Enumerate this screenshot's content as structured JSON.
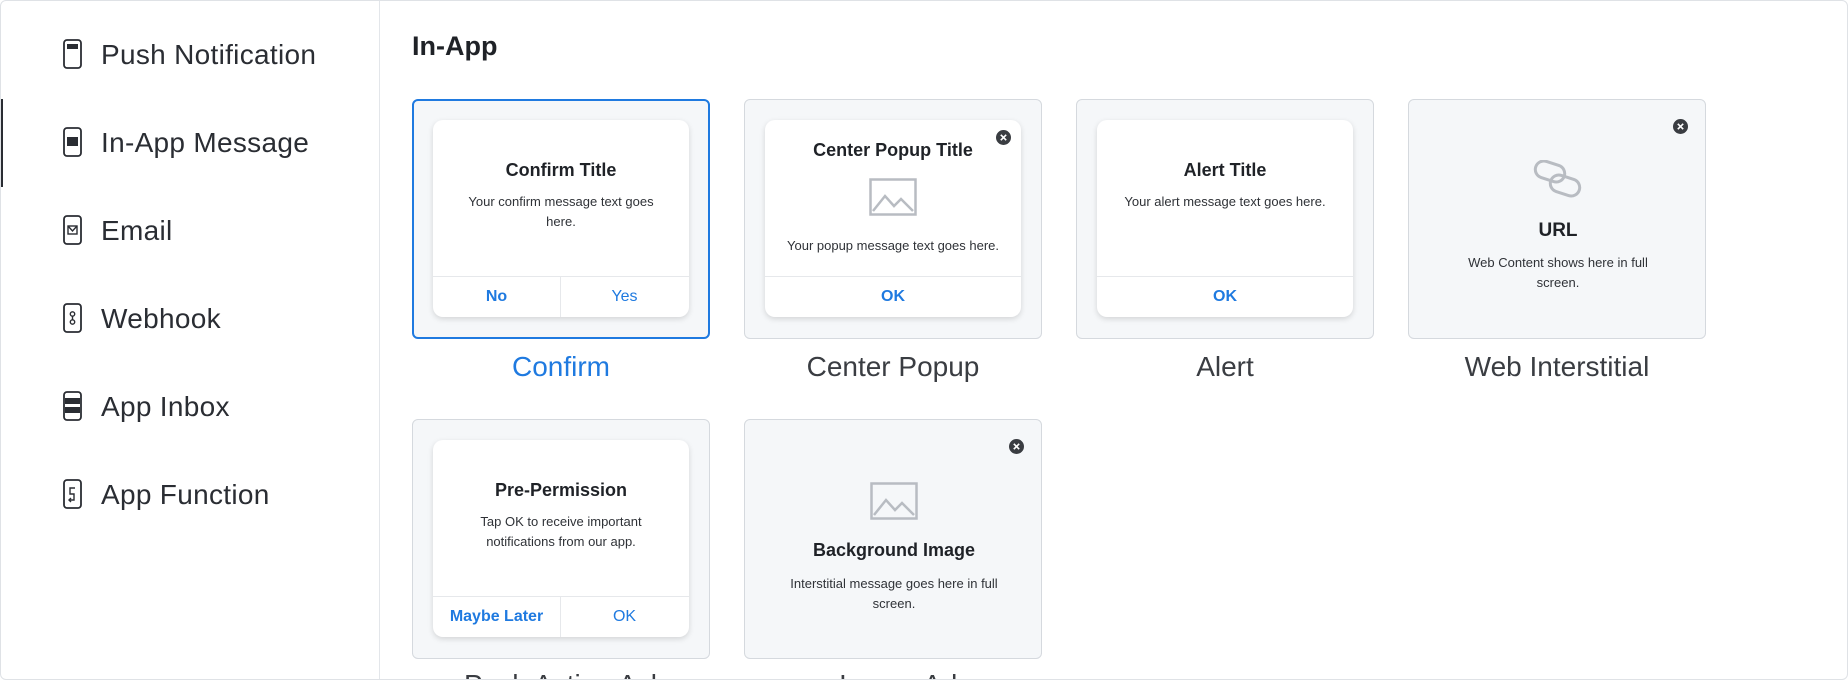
{
  "sidebar": {
    "items": [
      {
        "label": "Push Notification",
        "icon": "phone-push-icon"
      },
      {
        "label": "In-App Message",
        "icon": "phone-inapp-icon",
        "active": true
      },
      {
        "label": "Email",
        "icon": "phone-email-icon"
      },
      {
        "label": "Webhook",
        "icon": "phone-webhook-icon"
      },
      {
        "label": "App Inbox",
        "icon": "phone-inbox-icon"
      },
      {
        "label": "App Function",
        "icon": "phone-function-icon"
      }
    ]
  },
  "main": {
    "section_title": "In-App",
    "templates": [
      {
        "label": "Confirm",
        "title": "Confirm Title",
        "text": "Your confirm message text goes here.",
        "actions": [
          "No",
          "Yes"
        ]
      },
      {
        "label": "Center Popup",
        "title": "Center Popup Title",
        "text": "Your popup message text goes here.",
        "actions": [
          "OK"
        ]
      },
      {
        "label": "Alert",
        "title": "Alert Title",
        "text": "Your alert message text goes here.",
        "actions": [
          "OK"
        ]
      },
      {
        "label": "Web Interstitial",
        "title": "URL",
        "text": "Web Content shows here in full screen."
      },
      {
        "label": "Push Action Ask",
        "title": "Pre-Permission",
        "text": "Tap OK to receive important notifications from our app.",
        "actions": [
          "Maybe Later",
          "OK"
        ]
      },
      {
        "label": "Image Ad",
        "title": "Background Image",
        "text": "Interstitial message goes here in full screen."
      }
    ]
  },
  "colors": {
    "accent": "#1f7ae0",
    "text": "#2a2d33",
    "tile_bg": "#f5f7f9",
    "border": "#d5d9de"
  }
}
